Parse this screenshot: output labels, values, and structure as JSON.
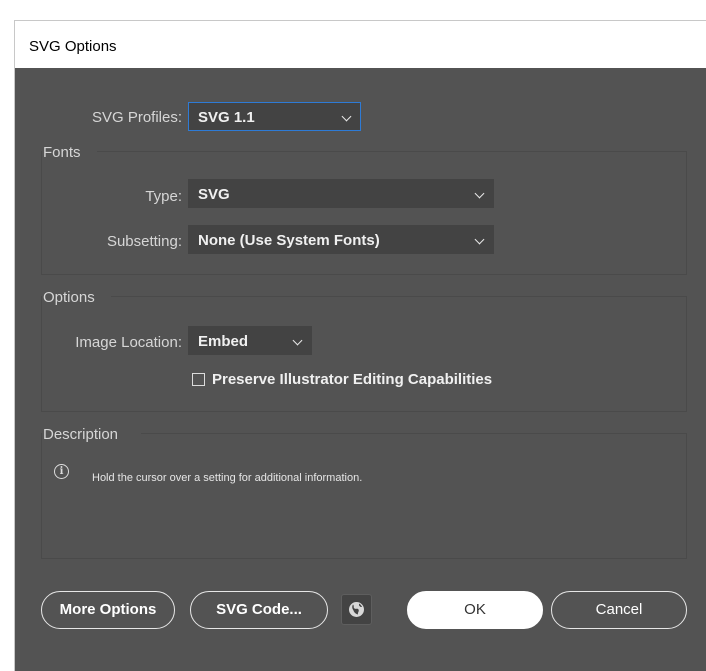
{
  "dialog": {
    "title": "SVG Options"
  },
  "svg_profiles": {
    "label": "SVG Profiles:",
    "value": "SVG 1.1"
  },
  "fonts": {
    "legend": "Fonts",
    "type_label": "Type:",
    "type_value": "SVG",
    "subsetting_label": "Subsetting:",
    "subsetting_value": "None (Use System Fonts)"
  },
  "options": {
    "legend": "Options",
    "image_location_label": "Image Location:",
    "image_location_value": "Embed",
    "preserve_label": "Preserve Illustrator Editing Capabilities",
    "preserve_checked": false
  },
  "description": {
    "legend": "Description",
    "text": "Hold the cursor over a setting for additional information."
  },
  "buttons": {
    "more_options": "More Options",
    "svg_code": "SVG Code...",
    "ok": "OK",
    "cancel": "Cancel",
    "web_icon": "globe-icon"
  },
  "colors": {
    "panel_bg": "#535353",
    "field_bg": "#434343",
    "focus_border": "#2e7bd6"
  }
}
